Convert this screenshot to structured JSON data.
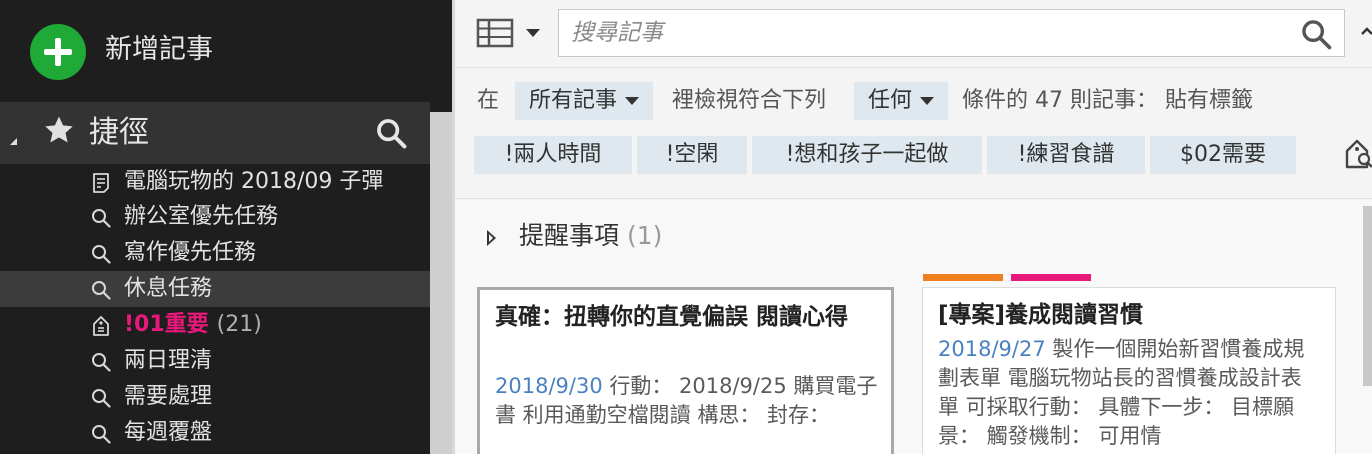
{
  "sidebar": {
    "new_note_label": "新增記事",
    "shortcuts_title": "捷徑",
    "items": [
      {
        "label": "電腦玩物的 2018/09 子彈",
        "icon": "note-icon",
        "count": "",
        "active": false,
        "important": false
      },
      {
        "label": "辦公室優先任務",
        "icon": "search-icon",
        "count": "",
        "active": false,
        "important": false
      },
      {
        "label": "寫作優先任務",
        "icon": "search-icon",
        "count": "",
        "active": false,
        "important": false
      },
      {
        "label": "休息任務",
        "icon": "search-icon",
        "count": "",
        "active": true,
        "important": false
      },
      {
        "label": "!01重要",
        "icon": "tag-icon",
        "count": "(21)",
        "active": false,
        "important": true
      },
      {
        "label": "兩日理清",
        "icon": "search-icon",
        "count": "",
        "active": false,
        "important": false
      },
      {
        "label": "需要處理",
        "icon": "search-icon",
        "count": "",
        "active": false,
        "important": false
      },
      {
        "label": "每週覆盤",
        "icon": "search-icon",
        "count": "",
        "active": false,
        "important": false
      }
    ]
  },
  "toolbar": {
    "search_placeholder": "搜尋記事",
    "search_value": ""
  },
  "filter": {
    "prefix": "在",
    "scope": "所有記事",
    "mid": "裡檢視符合下列",
    "match": "任何",
    "suffix": "條件的 47 則記事： 貼有標籤",
    "tags": [
      "!兩人時間",
      "!空閑",
      "!想和孩子一起做",
      "!練習食譜",
      "$02需要"
    ]
  },
  "reminders": {
    "label": "提醒事項",
    "count": "(1)"
  },
  "cards": [
    {
      "title": "真確：扭轉你的直覺偏誤 閱讀心得",
      "date": "2018/9/30",
      "body": " 行動： 2018/9/25 購買電子書 利用通勤空檔閱讀 構思： 封存："
    },
    {
      "title": "[專案]養成閱讀習慣",
      "date": "2018/9/27",
      "body": " 製作一個開始新習慣養成規劃表單 電腦玩物站長的習慣養成設計表單 可採取行動： 具體下一步： 目標願景： 觸發機制： 可用情"
    }
  ],
  "colors": {
    "accent_green": "#1fa937",
    "important_pink": "#e8197a",
    "date_blue": "#4a82c0",
    "card2_bar_orange": "#f07f1f",
    "card2_bar_pink": "#e8197a"
  }
}
